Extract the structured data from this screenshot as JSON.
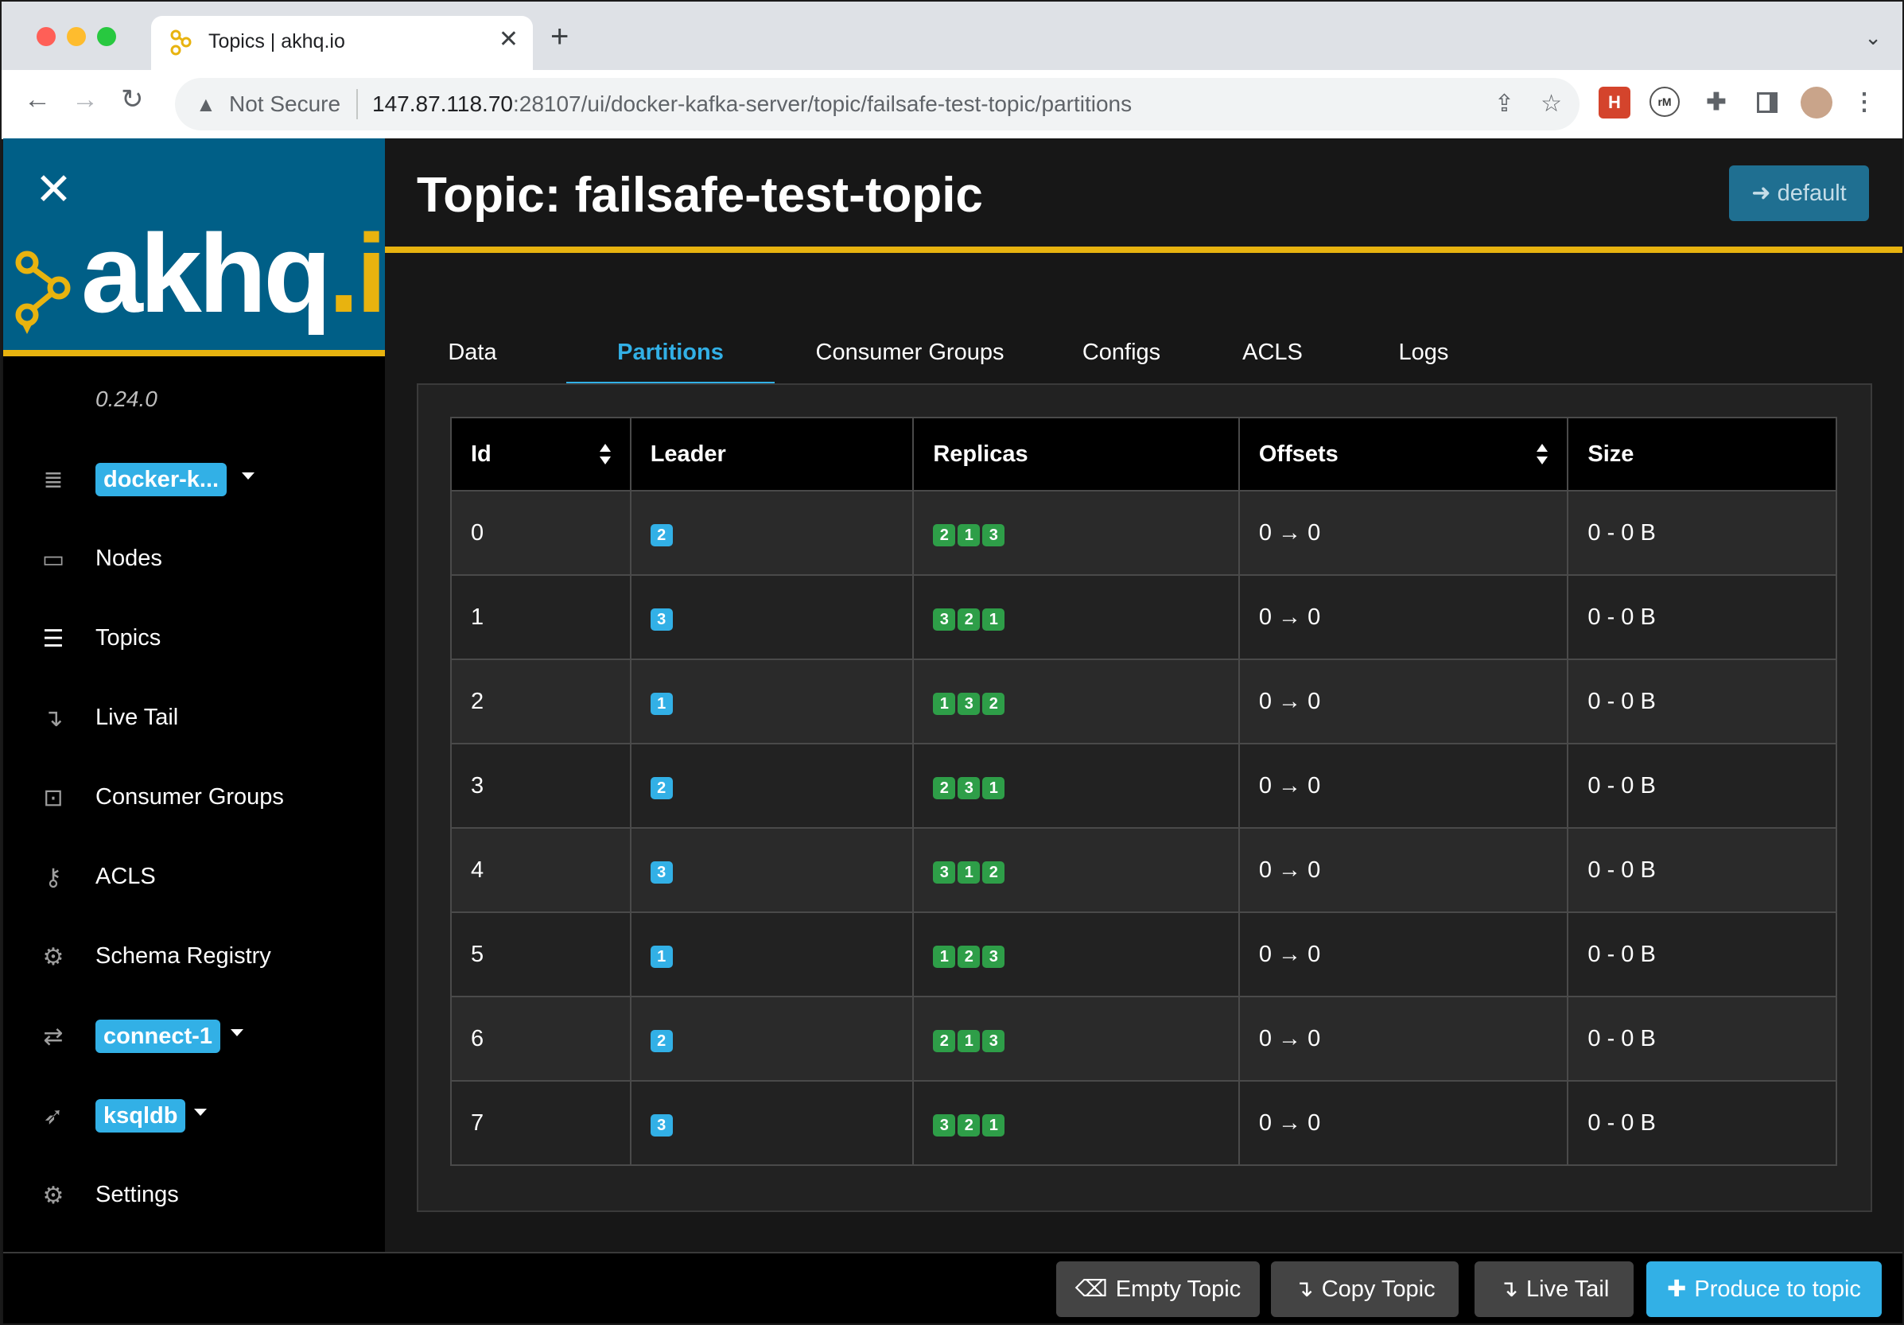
{
  "browser": {
    "tab_title": "Topics | akhq.io",
    "not_secure": "Not Secure",
    "url_host": "147.87.118.70",
    "url_rest": ":28107/ui/docker-kafka-server/topic/failsafe-test-topic/partitions"
  },
  "sidebar": {
    "logo_main": "akhq",
    "logo_dot": ".io",
    "version": "0.24.0",
    "items": [
      {
        "label": "docker-k...",
        "icon": "database-icon",
        "pill": true
      },
      {
        "label": "Nodes",
        "icon": "laptop-icon"
      },
      {
        "label": "Topics",
        "icon": "list-icon"
      },
      {
        "label": "Live Tail",
        "icon": "level-down-icon"
      },
      {
        "label": "Consumer Groups",
        "icon": "object-group-icon"
      },
      {
        "label": "ACLS",
        "icon": "key-icon"
      },
      {
        "label": "Schema Registry",
        "icon": "cogs-icon"
      },
      {
        "label": "connect-1",
        "icon": "exchange-icon",
        "pill": true
      },
      {
        "label": "ksqldb",
        "icon": "rocket-icon",
        "pill": true
      },
      {
        "label": "Settings",
        "icon": "gear-icon"
      }
    ]
  },
  "header": {
    "title": "Topic: failsafe-test-topic",
    "default_button": "default"
  },
  "tabs": [
    "Data",
    "Partitions",
    "Consumer Groups",
    "Configs",
    "ACLS",
    "Logs"
  ],
  "active_tab": "Partitions",
  "table": {
    "columns": [
      "Id",
      "Leader",
      "Replicas",
      "Offsets",
      "Size"
    ],
    "rows": [
      {
        "id": "0",
        "leader": "2",
        "replicas": [
          "2",
          "1",
          "3"
        ],
        "offsets": "0 → 0",
        "size": "0 - 0 B"
      },
      {
        "id": "1",
        "leader": "3",
        "replicas": [
          "3",
          "2",
          "1"
        ],
        "offsets": "0 → 0",
        "size": "0 - 0 B"
      },
      {
        "id": "2",
        "leader": "1",
        "replicas": [
          "1",
          "3",
          "2"
        ],
        "offsets": "0 → 0",
        "size": "0 - 0 B"
      },
      {
        "id": "3",
        "leader": "2",
        "replicas": [
          "2",
          "3",
          "1"
        ],
        "offsets": "0 → 0",
        "size": "0 - 0 B"
      },
      {
        "id": "4",
        "leader": "3",
        "replicas": [
          "3",
          "1",
          "2"
        ],
        "offsets": "0 → 0",
        "size": "0 - 0 B"
      },
      {
        "id": "5",
        "leader": "1",
        "replicas": [
          "1",
          "2",
          "3"
        ],
        "offsets": "0 → 0",
        "size": "0 - 0 B"
      },
      {
        "id": "6",
        "leader": "2",
        "replicas": [
          "2",
          "1",
          "3"
        ],
        "offsets": "0 → 0",
        "size": "0 - 0 B"
      },
      {
        "id": "7",
        "leader": "3",
        "replicas": [
          "3",
          "2",
          "1"
        ],
        "offsets": "0 → 0",
        "size": "0 - 0 B"
      }
    ]
  },
  "footer": {
    "empty_topic": "Empty Topic",
    "copy_topic": "Copy Topic",
    "live_tail": "Live Tail",
    "produce": "Produce to topic"
  },
  "colors": {
    "accent_blue": "#32b0e6",
    "brand_yellow": "#e8b30f",
    "brand_teal": "#005f87",
    "replica_green": "#2e9e48"
  }
}
